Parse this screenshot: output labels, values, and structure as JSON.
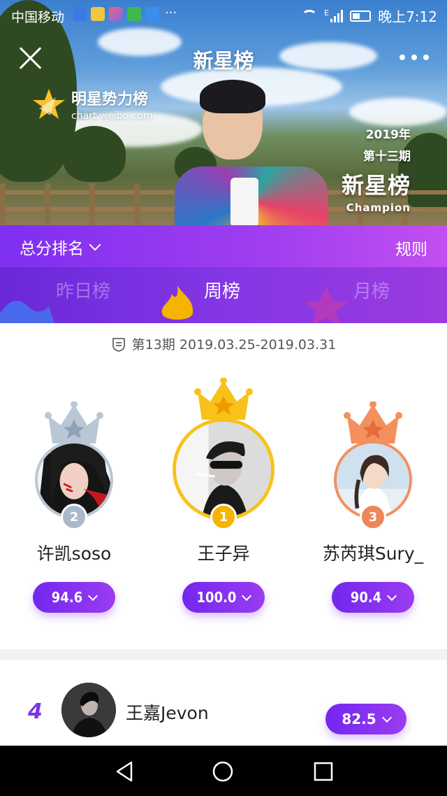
{
  "status_bar": {
    "carrier": "中国移动",
    "more": "···",
    "time": "晚上7:12",
    "network_type": "E"
  },
  "nav": {
    "title": "新星榜"
  },
  "hero": {
    "brand_name": "明星势力榜",
    "brand_url": "chart.weibo.com",
    "badge_year": "2019年",
    "badge_issue": "第十三期",
    "badge_title": "新星榜",
    "badge_sub": "Champion"
  },
  "sort_bar": {
    "selected": "总分排名",
    "rules": "规则"
  },
  "tabs": [
    {
      "label": "昨日榜",
      "active": false
    },
    {
      "label": "周榜",
      "active": true
    },
    {
      "label": "月榜",
      "active": false
    }
  ],
  "period": "第13期 2019.03.25-2019.03.31",
  "podium": [
    {
      "rank": "2",
      "name": "许凯soso",
      "score": "94.6",
      "color": "#a9b9c9"
    },
    {
      "rank": "1",
      "name": "王子异",
      "score": "100.0",
      "color": "#f5b400"
    },
    {
      "rank": "3",
      "name": "苏芮琪Sury_",
      "score": "90.4",
      "color": "#f0845a"
    }
  ],
  "list": [
    {
      "rank": "4",
      "name": "王嘉Jevon",
      "score": "82.5"
    }
  ],
  "colors": {
    "primary": "#7e2ff0",
    "gold": "#f5b400",
    "silver": "#a9b9c9",
    "bronze": "#f0845a"
  }
}
